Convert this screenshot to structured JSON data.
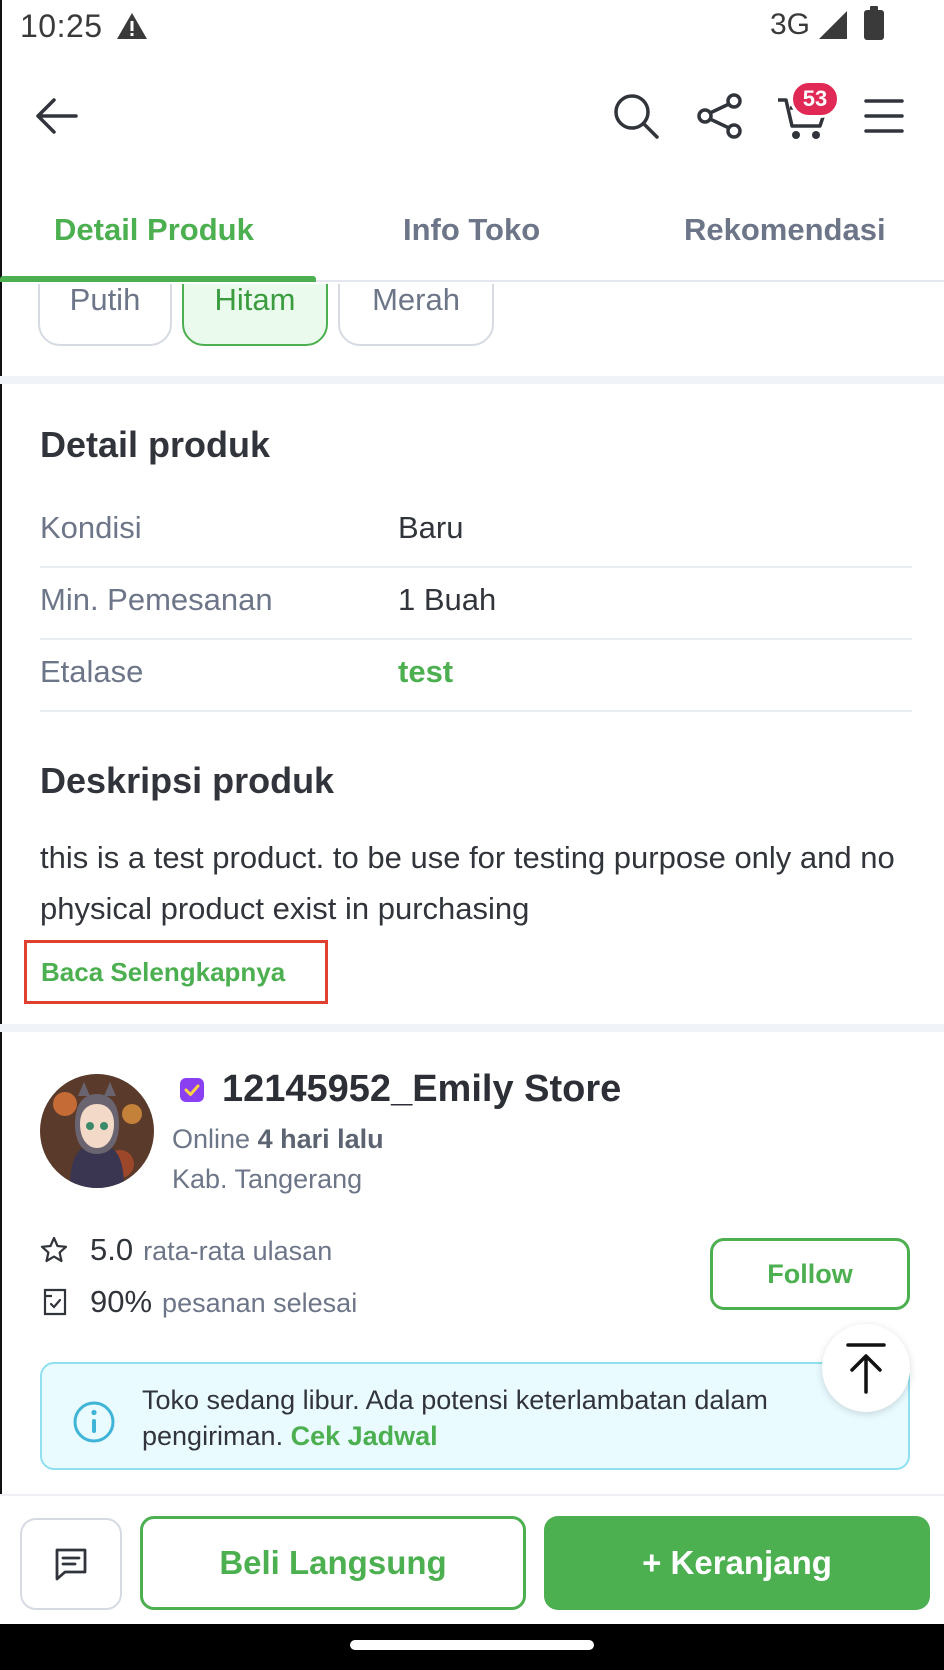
{
  "status_bar": {
    "time": "10:25",
    "network": "3G"
  },
  "header": {
    "cart_count": "53"
  },
  "tabs": [
    {
      "label": "Detail Produk"
    },
    {
      "label": "Info Toko"
    },
    {
      "label": "Rekomendasi"
    }
  ],
  "variants": [
    {
      "label": "Putih",
      "selected": false
    },
    {
      "label": "Hitam",
      "selected": true
    },
    {
      "label": "Merah",
      "selected": false
    }
  ],
  "detail": {
    "title": "Detail produk",
    "rows": [
      {
        "label": "Kondisi",
        "value": "Baru"
      },
      {
        "label": "Min. Pemesanan",
        "value": "1 Buah"
      },
      {
        "label": "Etalase",
        "value": "test"
      }
    ]
  },
  "description": {
    "title": "Deskripsi produk",
    "text": "this is a test product. to be use for testing purpose only and no physical product exist in purchasing",
    "read_more": "Baca Selengkapnya"
  },
  "store": {
    "name": "12145952_Emily Store",
    "online_prefix": "Online",
    "online_time": "4 hari lalu",
    "location": "Kab. Tangerang",
    "rating": "5.0",
    "rating_label": "rata-rata ulasan",
    "completion": "90%",
    "completion_label": "pesanan selesai",
    "follow_label": "Follow"
  },
  "notice": {
    "text": "Toko sedang libur. Ada potensi keterlambatan dalam pengiriman.",
    "link": "Cek Jadwal"
  },
  "actions": {
    "buy_now": "Beli Langsung",
    "add_to_cart": "+ Keranjang"
  },
  "colors": {
    "accent": "#4caf50",
    "badge": "#e02954",
    "highlight_box": "#e0412f"
  }
}
